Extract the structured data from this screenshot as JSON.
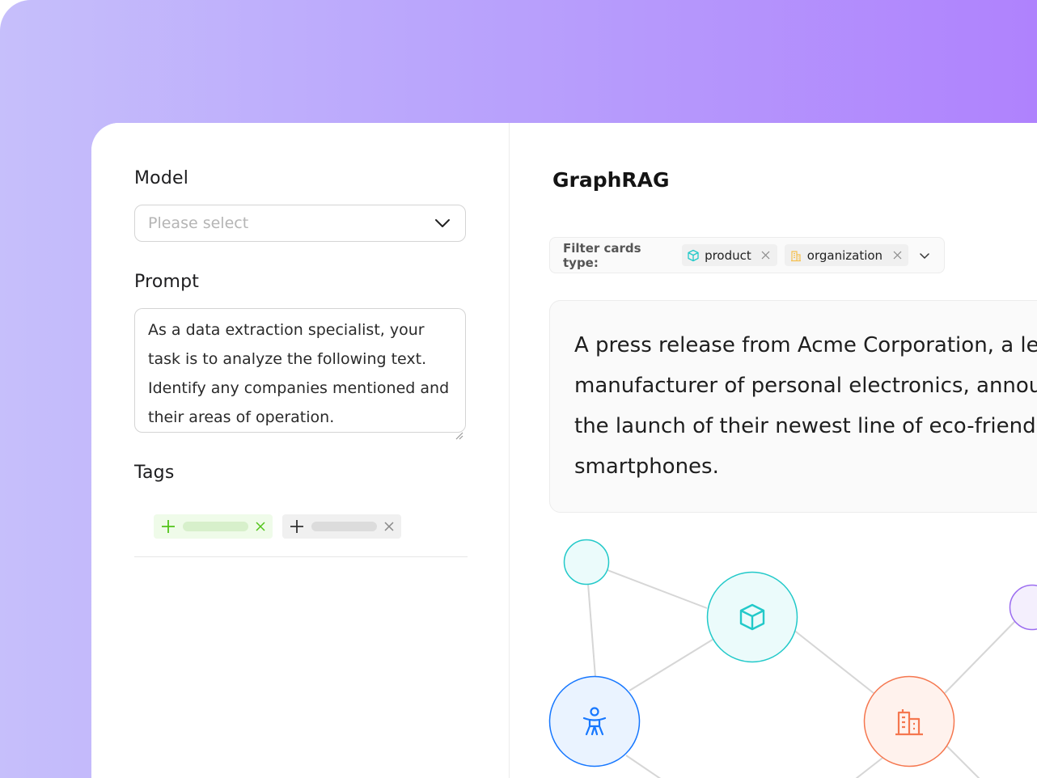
{
  "left": {
    "model": {
      "label": "Model",
      "placeholder": "Please select"
    },
    "prompt": {
      "label": "Prompt",
      "value": "As a data extraction specialist, your task is to analyze the following text. Identify any companies mentioned and their areas of operation."
    },
    "tags": {
      "label": "Tags"
    }
  },
  "right": {
    "title": "GraphRAG",
    "filter": {
      "label": "Filter cards type:",
      "chips": [
        {
          "label": "product",
          "icon": "cube-icon"
        },
        {
          "label": "organization",
          "icon": "building-icon"
        }
      ]
    },
    "text_card": {
      "lines": [
        "A press release from Acme Corporation, a leading",
        "manufacturer of personal electronics, announces",
        "the launch of their newest line of eco-friendly",
        "smartphones."
      ]
    },
    "graph": {
      "nodes": [
        {
          "icon": "none",
          "color": "#22c9c9"
        },
        {
          "icon": "cube-icon",
          "color": "#22c9c9"
        },
        {
          "icon": "person-icon",
          "color": "#1677ff"
        },
        {
          "icon": "building-icon",
          "color": "#f5774f"
        },
        {
          "icon": "none",
          "color": "#9b6cf0"
        }
      ]
    }
  },
  "colors": {
    "bg_gradient_start": "#c6bffb",
    "bg_gradient_end": "#af82fd",
    "green_tag": "#52c41a",
    "cyan": "#22c9c9",
    "blue": "#1677ff",
    "orange": "#f5774f",
    "purple": "#9b6cf0"
  }
}
